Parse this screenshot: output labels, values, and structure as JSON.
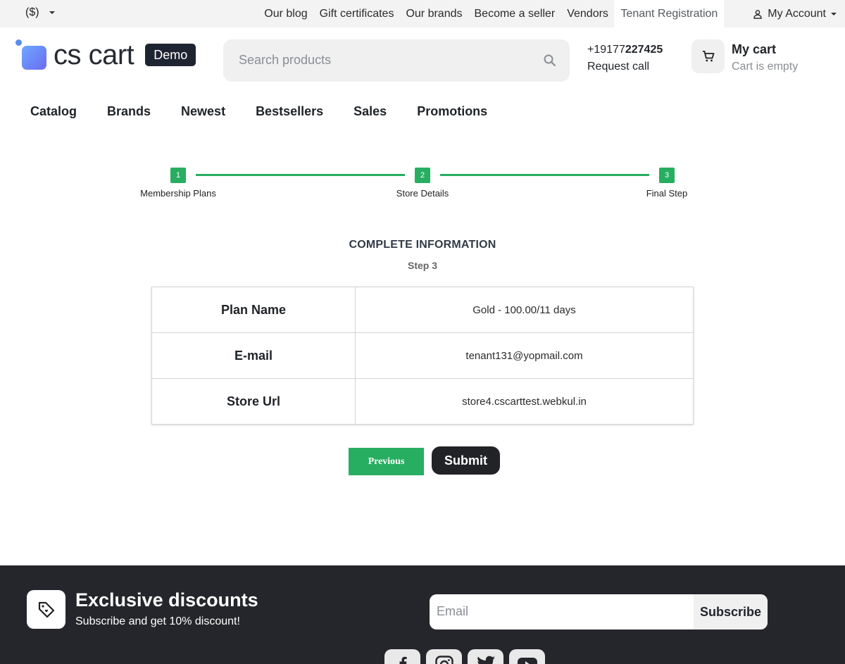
{
  "topbar": {
    "currency": "($)",
    "links": [
      "Our blog",
      "Gift certificates",
      "Our brands",
      "Become a seller",
      "Vendors",
      "Tenant Registration"
    ],
    "account": "My Account"
  },
  "header": {
    "logo_text": "cs cart",
    "demo_badge": "Demo",
    "search_placeholder": "Search products",
    "phone_prefix": "+19177",
    "phone_bold": "227425",
    "request_call": "Request call",
    "cart_title": "My cart",
    "cart_status": "Cart is empty"
  },
  "nav": [
    "Catalog",
    "Brands",
    "Newest",
    "Bestsellers",
    "Sales",
    "Promotions"
  ],
  "stepper": {
    "steps": [
      {
        "number": "1",
        "label": "Membership Plans"
      },
      {
        "number": "2",
        "label": "Store Details"
      },
      {
        "number": "3",
        "label": "Final Step"
      }
    ]
  },
  "main": {
    "title": "COMPLETE INFORMATION",
    "subtitle": "Step 3",
    "rows": [
      {
        "key": "Plan Name",
        "value": "Gold - 100.00/11 days"
      },
      {
        "key": "E-mail",
        "value": "tenant131@yopmail.com"
      },
      {
        "key": "Store Url",
        "value": "store4.cscarttest.webkul.in"
      }
    ],
    "previous_label": "Previous",
    "submit_label": "Submit"
  },
  "footer": {
    "discount_title": "Exclusive discounts",
    "discount_sub": "Subscribe and get 10% discount!",
    "email_placeholder": "Email",
    "subscribe_label": "Subscribe",
    "socials": [
      "facebook-icon",
      "instagram-icon",
      "twitter-icon",
      "youtube-icon"
    ]
  },
  "colors": {
    "accent_green": "#27ae60",
    "dark": "#25262b",
    "topbar_bg": "#f3f3f4"
  }
}
